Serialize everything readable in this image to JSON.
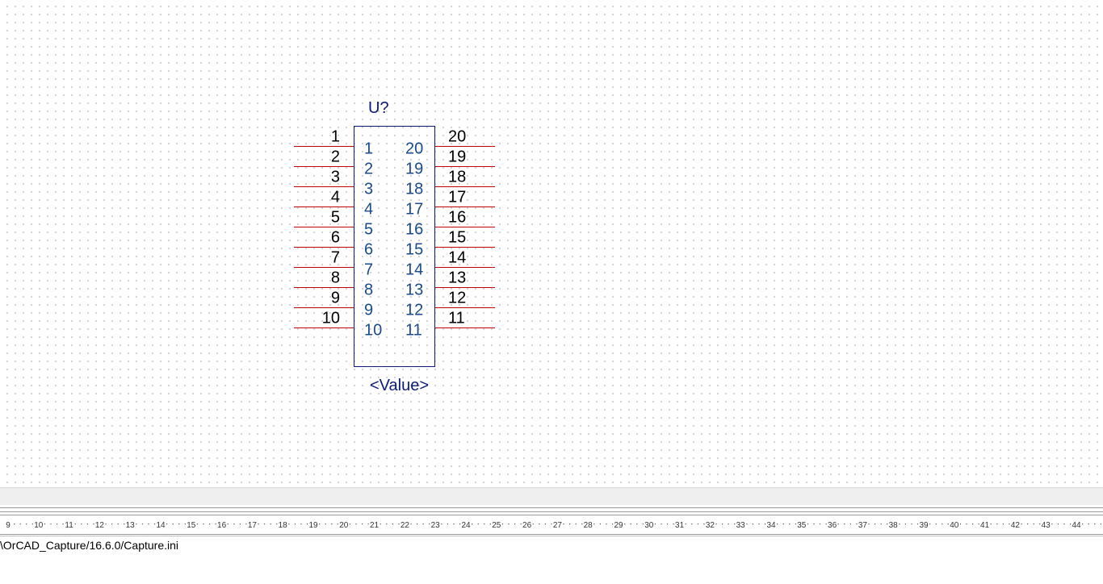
{
  "component": {
    "refdes": "U?",
    "value": "<Value>",
    "left_pins_outer": [
      "1",
      "2",
      "3",
      "4",
      "5",
      "6",
      "7",
      "8",
      "9",
      "10"
    ],
    "left_pins_inner": [
      "1",
      "2",
      "3",
      "4",
      "5",
      "6",
      "7",
      "8",
      "9",
      "10"
    ],
    "right_pins_outer": [
      "20",
      "19",
      "18",
      "17",
      "16",
      "15",
      "14",
      "13",
      "12",
      "11"
    ],
    "right_pins_inner": [
      "20",
      "19",
      "18",
      "17",
      "16",
      "15",
      "14",
      "13",
      "12",
      "11"
    ]
  },
  "colors": {
    "pin_wire": "#c00000",
    "body_outline": "#0a1a7a",
    "grid_dot": "#c8c8c8"
  },
  "ruler": {
    "labels": [
      "9",
      "10",
      "11",
      "12",
      "13",
      "14",
      "15",
      "16",
      "17",
      "18",
      "19",
      "20",
      "21",
      "22",
      "23",
      "24",
      "25",
      "26",
      "27",
      "28",
      "29",
      "30",
      "31",
      "32",
      "33",
      "34",
      "35",
      "36",
      "37",
      "38",
      "39",
      "40",
      "41",
      "42",
      "43",
      "44"
    ]
  },
  "status": {
    "path_text": "\\OrCAD_Capture/16.6.0/Capture.ini"
  }
}
